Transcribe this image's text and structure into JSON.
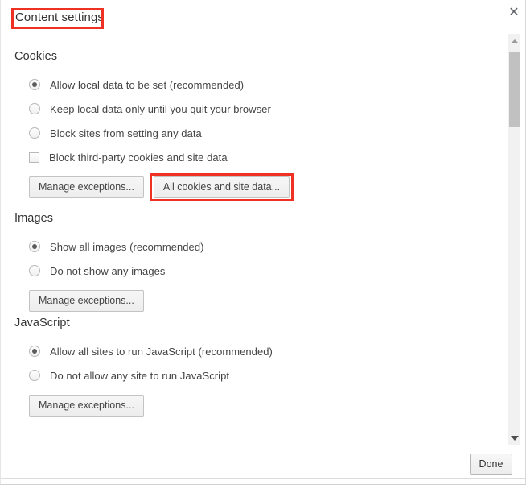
{
  "dialog": {
    "title": "Content settings",
    "close_icon": "close-icon",
    "title_highlight_color": "#ef3124"
  },
  "scrollbar": {
    "up_arrow_icon": "triangle-up-icon",
    "down_arrow_icon": "triangle-down-icon"
  },
  "sections": [
    {
      "title": "Cookies",
      "options": [
        {
          "type": "radio",
          "label": "Allow local data to be set (recommended)",
          "checked": true
        },
        {
          "type": "radio",
          "label": "Keep local data only until you quit your browser",
          "checked": false
        },
        {
          "type": "radio",
          "label": "Block sites from setting any data",
          "checked": false
        },
        {
          "type": "checkbox",
          "label": "Block third-party cookies and site data",
          "checked": false
        }
      ],
      "buttons": [
        {
          "label": "Manage exceptions...",
          "highlighted": false
        },
        {
          "label": "All cookies and site data...",
          "highlighted": true
        }
      ]
    },
    {
      "title": "Images",
      "options": [
        {
          "type": "radio",
          "label": "Show all images (recommended)",
          "checked": true
        },
        {
          "type": "radio",
          "label": "Do not show any images",
          "checked": false
        }
      ],
      "buttons": [
        {
          "label": "Manage exceptions...",
          "highlighted": false
        }
      ]
    },
    {
      "title": "JavaScript",
      "options": [
        {
          "type": "radio",
          "label": "Allow all sites to run JavaScript (recommended)",
          "checked": true
        },
        {
          "type": "radio",
          "label": "Do not allow any site to run JavaScript",
          "checked": false
        }
      ],
      "buttons": [
        {
          "label": "Manage exceptions...",
          "highlighted": false
        }
      ]
    }
  ],
  "footer": {
    "done_label": "Done"
  }
}
